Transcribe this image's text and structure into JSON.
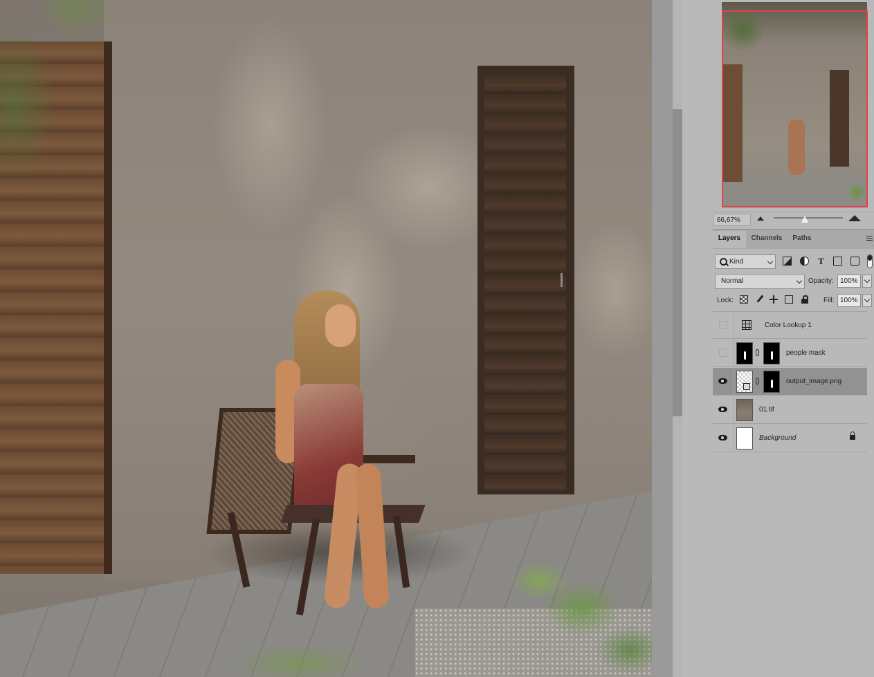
{
  "navigator": {
    "zoom": "66,67%"
  },
  "layers_panel": {
    "tabs": [
      {
        "label": "Layers",
        "active": true
      },
      {
        "label": "Channels",
        "active": false
      },
      {
        "label": "Paths",
        "active": false
      }
    ],
    "filter_kind": "Kind",
    "filter_icons": [
      "pixel-filter-icon",
      "adjustment-filter-icon",
      "type-filter-icon",
      "shape-filter-icon",
      "smart-object-filter-icon"
    ],
    "blend_mode": "Normal",
    "opacity_label": "Opacity:",
    "opacity_value": "100%",
    "lock_label": "Lock:",
    "fill_label": "Fill:",
    "fill_value": "100%",
    "layers": [
      {
        "name": "Color Lookup 1",
        "visible": false,
        "type": "adjustment",
        "selected": false
      },
      {
        "name": "people mask",
        "visible": false,
        "type": "masked",
        "selected": false
      },
      {
        "name": "output_image.png",
        "visible": true,
        "type": "smart-masked",
        "selected": true
      },
      {
        "name": "01.tif",
        "visible": true,
        "type": "pixel",
        "selected": false
      },
      {
        "name": "Background",
        "visible": true,
        "type": "background",
        "selected": false,
        "locked": true
      }
    ]
  },
  "colors": {
    "view_box": "#e0414b",
    "panel_bg": "#b9b9b9",
    "selected_row": "#929292"
  }
}
